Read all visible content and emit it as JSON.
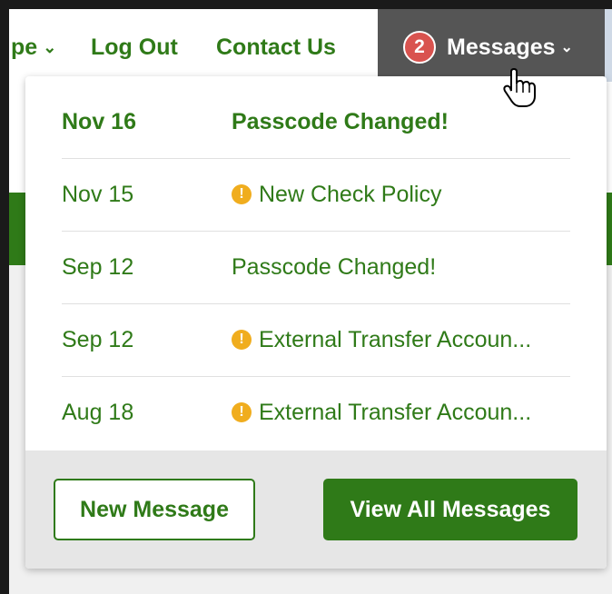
{
  "nav": {
    "cut_item_label": "pe",
    "logout_label": "Log Out",
    "contact_label": "Contact Us",
    "messages_label": "Messages",
    "unread_count": "2"
  },
  "messages": [
    {
      "date": "Nov 16",
      "subject": "Passcode Changed!",
      "unread": true,
      "alert": false
    },
    {
      "date": "Nov 15",
      "subject": "New Check Policy",
      "unread": false,
      "alert": true
    },
    {
      "date": "Sep 12",
      "subject": "Passcode Changed!",
      "unread": false,
      "alert": false
    },
    {
      "date": "Sep 12",
      "subject": "External Transfer Accoun...",
      "unread": false,
      "alert": true
    },
    {
      "date": "Aug 18",
      "subject": "External Transfer Accoun...",
      "unread": false,
      "alert": true
    }
  ],
  "footer": {
    "new_message_label": "New Message",
    "view_all_label": "View All Messages"
  },
  "colors": {
    "brand_green": "#2f7a18",
    "badge_red": "#d9534f",
    "alert_orange": "#f0ad1e",
    "tab_dark": "#555555"
  }
}
